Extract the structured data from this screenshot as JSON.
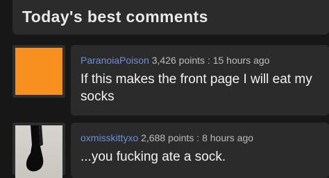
{
  "header": {
    "title": "Today's best comments"
  },
  "comments": [
    {
      "username": "ParanoiaPoison",
      "points_text": "3,426 points : 15 hours ago",
      "body": "If this makes the front page I will eat my socks",
      "avatar": "orange-square-avatar"
    },
    {
      "username": "oxmisskittyxo",
      "points_text": "2,688 points : 8 hours ago",
      "body": "...you fucking ate a sock.",
      "avatar": "sock-photo-avatar"
    }
  ],
  "colors": {
    "background": "#171717",
    "panel": "#2b2b2b",
    "username": "#6e8fd6",
    "meta_text": "#bdbdbd",
    "body_text": "#f2f2f2",
    "orange_avatar": "#f7901e"
  }
}
